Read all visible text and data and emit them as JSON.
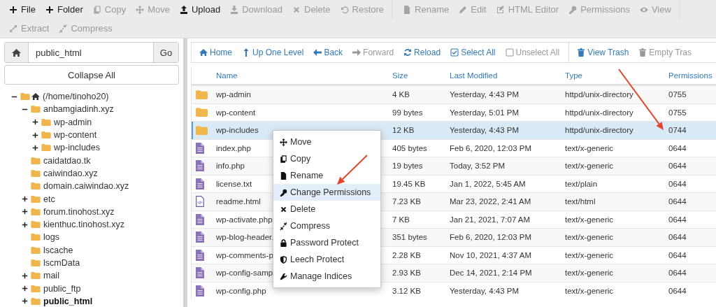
{
  "toolbar": [
    [
      [
        {
          "kind": "plus",
          "label": "File",
          "disabled": false
        },
        {
          "kind": "plus",
          "label": "Folder",
          "disabled": false
        },
        {
          "kind": "copy",
          "label": "Copy",
          "disabled": true
        },
        {
          "kind": "move",
          "label": "Move",
          "disabled": true
        },
        {
          "kind": "upload",
          "label": "Upload",
          "disabled": false
        },
        {
          "kind": "download",
          "label": "Download",
          "disabled": true
        },
        {
          "kind": "delete",
          "label": "Delete",
          "disabled": true
        },
        {
          "kind": "restore",
          "label": "Restore",
          "disabled": true
        }
      ],
      [
        {
          "kind": "rename",
          "label": "Rename",
          "disabled": true
        },
        {
          "kind": "edit",
          "label": "Edit",
          "disabled": true
        },
        {
          "kind": "htmledit",
          "label": "HTML Editor",
          "disabled": true
        },
        {
          "kind": "permissions",
          "label": "Permissions",
          "disabled": true
        },
        {
          "kind": "view",
          "label": "View",
          "disabled": true
        }
      ]
    ],
    [
      [
        {
          "kind": "extract",
          "label": "Extract",
          "disabled": true
        },
        {
          "kind": "compress",
          "label": "Compress",
          "disabled": true
        }
      ]
    ]
  ],
  "sidebar": {
    "path": "public_html",
    "go": "Go",
    "collapse": "Collapse All",
    "tree": [
      {
        "kind": "home",
        "label": "(/home/tinoho20)",
        "expanded": true,
        "selected": false,
        "children": [
          {
            "kind": "folder",
            "label": "anbamgiadinh.xyz",
            "expanded": true,
            "selected": false,
            "children": [
              {
                "kind": "folder",
                "label": "wp-admin",
                "expanded": false,
                "selected": false
              },
              {
                "kind": "folder",
                "label": "wp-content",
                "expanded": false,
                "selected": false
              },
              {
                "kind": "folder",
                "label": "wp-includes",
                "expanded": false,
                "selected": false
              }
            ]
          },
          {
            "kind": "folder",
            "label": "caidatdao.tk",
            "selected": false
          },
          {
            "kind": "folder",
            "label": "caiwindao.xyz",
            "selected": false
          },
          {
            "kind": "folder",
            "label": "domain.caiwindao.xyz",
            "selected": false
          },
          {
            "kind": "folder",
            "label": "etc",
            "expanded": false,
            "selected": false
          },
          {
            "kind": "folder",
            "label": "forum.tinohost.xyz",
            "expanded": false,
            "selected": false
          },
          {
            "kind": "folder",
            "label": "kienthuc.tinohost.xyz",
            "expanded": false,
            "selected": false
          },
          {
            "kind": "folder",
            "label": "logs",
            "selected": false
          },
          {
            "kind": "folder",
            "label": "lscache",
            "selected": false
          },
          {
            "kind": "folder",
            "label": "lscmData",
            "selected": false
          },
          {
            "kind": "folder",
            "label": "mail",
            "expanded": false,
            "selected": false
          },
          {
            "kind": "folder",
            "label": "public_ftp",
            "expanded": false,
            "selected": false
          },
          {
            "kind": "folder",
            "label": "public_html",
            "expanded": false,
            "selected": true
          }
        ]
      }
    ]
  },
  "navbar": [
    [
      {
        "kind": "home",
        "label": "Home",
        "disabled": false
      },
      {
        "kind": "up",
        "label": "Up One Level",
        "disabled": false
      },
      {
        "kind": "back",
        "label": "Back",
        "disabled": false
      },
      {
        "kind": "forward",
        "label": "Forward",
        "disabled": true
      },
      {
        "kind": "reload",
        "label": "Reload",
        "disabled": false
      },
      {
        "kind": "selectall",
        "label": "Select All",
        "disabled": false
      },
      {
        "kind": "unselectall",
        "label": "Unselect All",
        "disabled": true
      }
    ],
    [
      {
        "kind": "trash",
        "label": "View Trash",
        "disabled": false
      },
      {
        "kind": "trash",
        "label": "Empty Tras",
        "disabled": true
      }
    ]
  ],
  "table": {
    "columns": [
      "Name",
      "Size",
      "Last Modified",
      "Type",
      "Permissions"
    ],
    "rows": [
      {
        "kind": "folder",
        "name": "wp-admin",
        "size": "4 KB",
        "modified": "Yesterday, 4:43 PM",
        "type": "httpd/unix-directory",
        "permissions": "0755",
        "selected": false
      },
      {
        "kind": "folder",
        "name": "wp-content",
        "size": "99 bytes",
        "modified": "Yesterday, 5:01 PM",
        "type": "httpd/unix-directory",
        "permissions": "0755",
        "selected": false
      },
      {
        "kind": "folder",
        "name": "wp-includes",
        "size": "12 KB",
        "modified": "Yesterday, 4:43 PM",
        "type": "httpd/unix-directory",
        "permissions": "0744",
        "selected": true
      },
      {
        "kind": "file",
        "name": "index.php",
        "size": "405 bytes",
        "modified": "Feb 6, 2020, 12:03 PM",
        "type": "text/x-generic",
        "permissions": "0644",
        "selected": false
      },
      {
        "kind": "file",
        "name": "info.php",
        "size": "19 bytes",
        "modified": "Today, 3:52 PM",
        "type": "text/x-generic",
        "permissions": "0644",
        "selected": false
      },
      {
        "kind": "file",
        "name": "license.txt",
        "size": "19.45 KB",
        "modified": "Jan 1, 2022, 5:45 AM",
        "type": "text/plain",
        "permissions": "0644",
        "selected": false
      },
      {
        "kind": "html",
        "name": "readme.html",
        "size": "7.23 KB",
        "modified": "Mar 23, 2022, 2:41 AM",
        "type": "text/html",
        "permissions": "0644",
        "selected": false
      },
      {
        "kind": "file",
        "name": "wp-activate.php",
        "size": "7 KB",
        "modified": "Jan 21, 2021, 7:07 AM",
        "type": "text/x-generic",
        "permissions": "0644",
        "selected": false
      },
      {
        "kind": "file",
        "name": "wp-blog-header.",
        "size": "351 bytes",
        "modified": "Feb 6, 2020, 12:03 PM",
        "type": "text/x-generic",
        "permissions": "0644",
        "selected": false
      },
      {
        "kind": "file",
        "name": "wp-comments-p",
        "size": "2.28 KB",
        "modified": "Nov 10, 2021, 4:37 AM",
        "type": "text/x-generic",
        "permissions": "0644",
        "selected": false
      },
      {
        "kind": "file",
        "name": "wp-config-samp",
        "size": "2.93 KB",
        "modified": "Dec 14, 2021, 2:14 PM",
        "type": "text/x-generic",
        "permissions": "0644",
        "selected": false
      },
      {
        "kind": "file",
        "name": "wp-config.php",
        "size": "3.12 KB",
        "modified": "Yesterday, 4:43 PM",
        "type": "text/x-generic",
        "permissions": "0644",
        "selected": false
      }
    ]
  },
  "context_menu": {
    "items": [
      {
        "kind": "move",
        "label": "Move",
        "selected": false
      },
      {
        "kind": "copy",
        "label": "Copy",
        "selected": false
      },
      {
        "kind": "rename",
        "label": "Rename",
        "selected": false
      },
      {
        "kind": "key",
        "label": "Change Permissions",
        "selected": true
      },
      {
        "kind": "delete",
        "label": "Delete",
        "selected": false
      },
      {
        "kind": "compress",
        "label": "Compress",
        "selected": false
      },
      {
        "kind": "lock",
        "label": "Password Protect",
        "selected": false
      },
      {
        "kind": "shield",
        "label": "Leech Protect",
        "selected": false
      },
      {
        "kind": "wrench",
        "label": "Manage Indices",
        "selected": false
      }
    ]
  }
}
